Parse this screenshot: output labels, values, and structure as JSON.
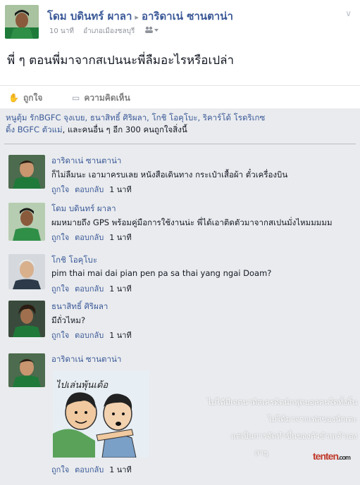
{
  "post": {
    "author": "โดม บดินทร์ ผาลา",
    "arrow": "▸",
    "target": "อาริดาเน่ ซานตาน่า",
    "time": "10 นาที",
    "location": "อำเภอเมืองชลบุรี",
    "privacy_icon": "friends-icon",
    "text": "พี่ ๆ ตอนพี่มาจากสเปนนะพี่ลืมอะไรหรือเปล่า",
    "like_label": "ถูกใจ",
    "comment_label": "ความคิดเห็น"
  },
  "likes": {
    "names": "หนูตุ้ม รักBGFC จุงเบย, ธนาสิทธิ์ ศิริผลา, โกชิ โอคุโบะ, ริคาร์โด้ โรดริเกซ",
    "mid": "ดิ้ง BGFC ตัวแม่",
    "and": ", และคนอื่น ๆ อีก 300 คนถูกใจสิ่งนี้"
  },
  "comments": [
    {
      "name": "อาริดาเน่ ซานตาน่า",
      "text": "ก็ไม่ลืมนะ เอามาครบเลย หนังสือเดินทาง กระเป๋าเสื้อผ้า ตั๋วเครื่องบิน",
      "like": "ถูกใจ",
      "reply": "ตอบกลับ",
      "time": "1 นาที"
    },
    {
      "name": "โดม บดินทร์ ผาลา",
      "text": "ผมหมายถึง GPS พร้อมคู่มือการใช้งานน่ะ พี่ได้เอาติดตัวมาจากสเปนมั่งไหมมมมม",
      "like": "ถูกใจ",
      "reply": "ตอบกลับ",
      "time": "1 นาที"
    },
    {
      "name": "โกชิ โอคุโบะ",
      "text": "pim thai mai dai pian pen pa sa thai yang ngai Doam?",
      "like": "ถูกใจ",
      "reply": "ตอบกลับ",
      "time": "1 นาที"
    },
    {
      "name": "ธนาสิทธิ์ ศิริผลา",
      "text": "มีถั่วไหม?",
      "like": "ถูกใจ",
      "reply": "ตอบกลับ",
      "time": "1 นาที"
    },
    {
      "name": "อาริดาเน่ ซานตาน่า",
      "text": "",
      "like": "ถูกใจ",
      "reply": "ตอบกลับ",
      "time": "1 นาที"
    }
  ],
  "sticker": {
    "text": "ไปเล่นพุ้นเด้อ"
  },
  "watermark": {
    "line1": "ไม่ได้มีเจตนาดิสเครดิตนักฟุตบอลคนใดทั้งสิ้น",
    "line2": "ไม่ได้มาจากเฟสของนักเตะ",
    "line3": "แต่เป็นการจัดทำขึ้นของตัวข้าพเจ้าเอง",
    "line4": "สาธุ",
    "logo": "tenten",
    "logo_suffix": ".com"
  }
}
